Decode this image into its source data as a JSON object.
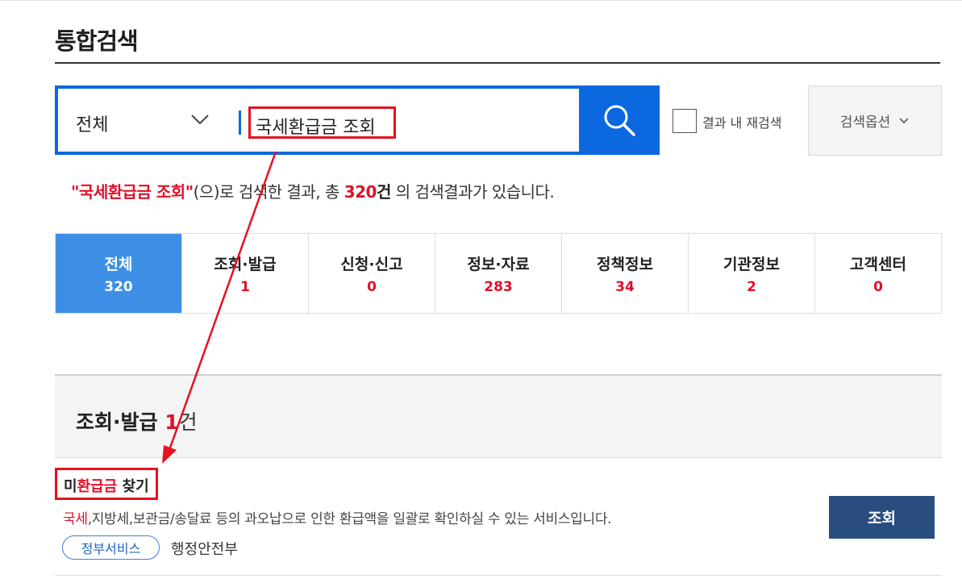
{
  "page": {
    "title": "통합검색"
  },
  "search": {
    "scope": "전체",
    "query": "국세환급금 조회",
    "recheck_label": "결과 내 재검색",
    "options_label": "검색옵션"
  },
  "summary": {
    "quote_open": "\"",
    "keyword": "국세환급금 조회",
    "quote_close": "\"",
    "text1": "(으)로 검색한 결과, 총 ",
    "total": "320",
    "total_unit": "건",
    "text2": " 의 검색결과가 있습니다."
  },
  "tabs": [
    {
      "label": "전체",
      "count": "320",
      "active": true
    },
    {
      "label": "조회·발급",
      "count": "1"
    },
    {
      "label": "신청·신고",
      "count": "0"
    },
    {
      "label": "정보·자료",
      "count": "283"
    },
    {
      "label": "정책정보",
      "count": "34"
    },
    {
      "label": "기관정보",
      "count": "2"
    },
    {
      "label": "고객센터",
      "count": "0"
    }
  ],
  "section": {
    "title": "조회·발급",
    "count": "1",
    "unit": "건"
  },
  "result": {
    "title_pre": "미",
    "title_hl": "환급금",
    "title_post": " 찾기",
    "desc_hl": "국세",
    "desc_rest": ",지방세,보관금/송달료 등의 과오납으로 인한 환급액을 일괄로 확인하실 수 있는 서비스입니다.",
    "tag": "정부서비스",
    "agency": "행정안전부",
    "action_label": "조회"
  },
  "colors": {
    "primary_blue": "#0b68de",
    "active_tab": "#3d8fe6",
    "highlight_red": "#e0102a",
    "button_navy": "#2a4d80"
  }
}
